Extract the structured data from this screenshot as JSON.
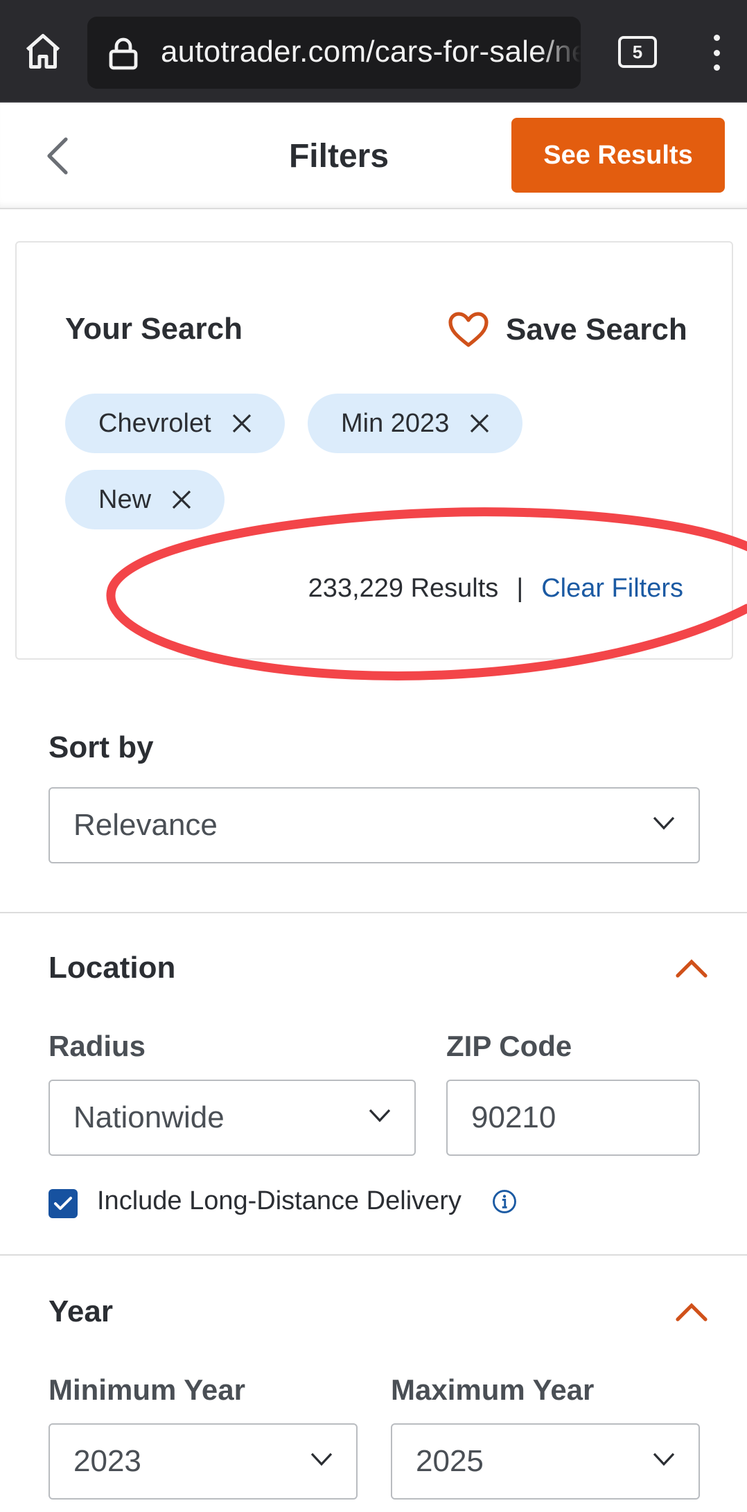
{
  "browser": {
    "url": "autotrader.com/cars-for-sale/ne",
    "tab_count": "5",
    "icons": [
      "home-icon",
      "lock-icon",
      "tabs-icon",
      "more-vert-icon"
    ]
  },
  "header": {
    "title": "Filters",
    "see_results_label": "See Results",
    "back_icon": "chevron-left-icon"
  },
  "search": {
    "title": "Your Search",
    "save_label": "Save Search",
    "chips": [
      {
        "label": "Chevrolet"
      },
      {
        "label": "Min 2023"
      },
      {
        "label": "New"
      }
    ],
    "results_count": "233,229 Results",
    "separator": "|",
    "clear_label": "Clear Filters"
  },
  "sort": {
    "label": "Sort by",
    "value": "Relevance"
  },
  "location": {
    "title": "Location",
    "radius_label": "Radius",
    "radius_value": "Nationwide",
    "zip_label": "ZIP Code",
    "zip_value": "90210",
    "delivery_label": "Include Long-Distance Delivery",
    "delivery_checked": true
  },
  "year": {
    "title": "Year",
    "min_label": "Minimum Year",
    "min_value": "2023",
    "max_label": "Maximum Year",
    "max_value": "2025"
  },
  "colors": {
    "accent": "#e35d0f",
    "link": "#1b5aa3",
    "chip_bg": "#dcecfb",
    "checkbox": "#1752a0",
    "annotation": "#f23b3f"
  }
}
